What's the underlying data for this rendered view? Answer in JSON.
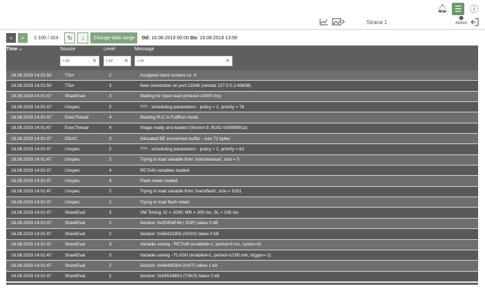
{
  "header": {
    "strana_label": "Strana 1",
    "user_label": "Admin"
  },
  "toolbar": {
    "prev_label": "<",
    "next_label": ">",
    "range": "1-100 / 324",
    "change_date_label": "Change date range",
    "od_label": "Od:",
    "od_value": "16.08.2019 00:00",
    "do_label": "Do:",
    "do_value": "16.08.2019 13:56"
  },
  "table": {
    "columns": {
      "time": "Time",
      "source": "Source",
      "level": "Level",
      "message": "Message"
    },
    "filter_placeholder": "Filtr",
    "rows": [
      {
        "time": "16.08.2019 14:01:50",
        "source": "TSvr",
        "level": "2",
        "message": "Assigned client context no. 0"
      },
      {
        "time": "16.08.2019 14:01:50",
        "source": "TSvr",
        "level": "3",
        "message": "New connection on port 12346 (remote 127.0.0.1:46608)"
      },
      {
        "time": "16.08.2019 14:01:47",
        "source": "SharkEval",
        "level": "3",
        "message": "Waiting for input read (timeout 10000 ms)"
      },
      {
        "time": "16.08.2019 14:01:47",
        "source": "Unspec",
        "level": "2",
        "message": "??? - scheduling parameters - policy = 2, priority = 78"
      },
      {
        "time": "16.08.2019 14:01:47",
        "source": "ExecThread",
        "level": "4",
        "message": "Starting PLC in FullRun mode"
      },
      {
        "time": "16.08.2019 14:01:47",
        "source": "ExecThread",
        "level": "4",
        "message": "Image ready and loaded (Version 9, BUID 0x569f981a)"
      },
      {
        "time": "16.08.2019 14:01:47",
        "source": "DDAC",
        "level": "3",
        "message": "Allocated BE conversion buffer - size 72 bytes"
      },
      {
        "time": "16.08.2019 14:01:47",
        "source": "Unspec",
        "level": "2",
        "message": "??? - scheduling parameters - policy = 2, priority = 61"
      },
      {
        "time": "16.08.2019 14:01:47",
        "source": "Unspec",
        "level": "2",
        "message": "Trying to load variable from '/vars/manual', size = 0"
      },
      {
        "time": "16.08.2019 14:01:47",
        "source": "Unspec",
        "level": "4",
        "message": "RETAIN variables loaded"
      },
      {
        "time": "16.08.2019 14:01:47",
        "source": "Unspec",
        "level": "4",
        "message": "Flash retain loaded"
      },
      {
        "time": "16.08.2019 14:01:47",
        "source": "Unspec",
        "level": "2",
        "message": "Trying to load variable from '/vars/flash', size = 1031"
      },
      {
        "time": "16.08.2019 14:01:47",
        "source": "Unspec",
        "level": "2",
        "message": "Trying to load flash retain"
      },
      {
        "time": "16.08.2019 14:01:47",
        "source": "SharkEval",
        "level": "3",
        "message": "VM Timing: IC = 1000, MR = 200 ms, SL = 100 ms"
      },
      {
        "time": "16.08.2019 14:01:47",
        "source": "SharkEval",
        "level": "2",
        "message": "Section: 0x20454F46 ( EOF) takes 0 kB"
      },
      {
        "time": "16.08.2019 14:01:47",
        "source": "SharkEval",
        "level": "2",
        "message": "Section: 0x56415356 (VASV) takes 0 kB"
      },
      {
        "time": "16.08.2019 14:01:47",
        "source": "SharkEval",
        "level": "3",
        "message": "Variable saving - RETAIN (enabled=1, period=0 ms, cycles=0)"
      },
      {
        "time": "16.08.2019 14:01:47",
        "source": "SharkEval",
        "level": "3",
        "message": "Variable saving - FLASH (enabled=1, period=1/180 min, trigger=-1)"
      },
      {
        "time": "16.08.2019 14:01:47",
        "source": "SharkEval",
        "level": "2",
        "message": "Section: 0x48495354 (HIST) takes 1 kB"
      },
      {
        "time": "16.08.2019 14:01:47",
        "source": "SharkEval",
        "level": "2",
        "message": "Section: 0x54534B53 (TSKS) takes 0 kB"
      }
    ]
  },
  "colors": {
    "accent": "#7fa67f",
    "header_bg": "#5f5f5f",
    "row_even": "#6e6e6e",
    "row_odd": "#595959"
  }
}
